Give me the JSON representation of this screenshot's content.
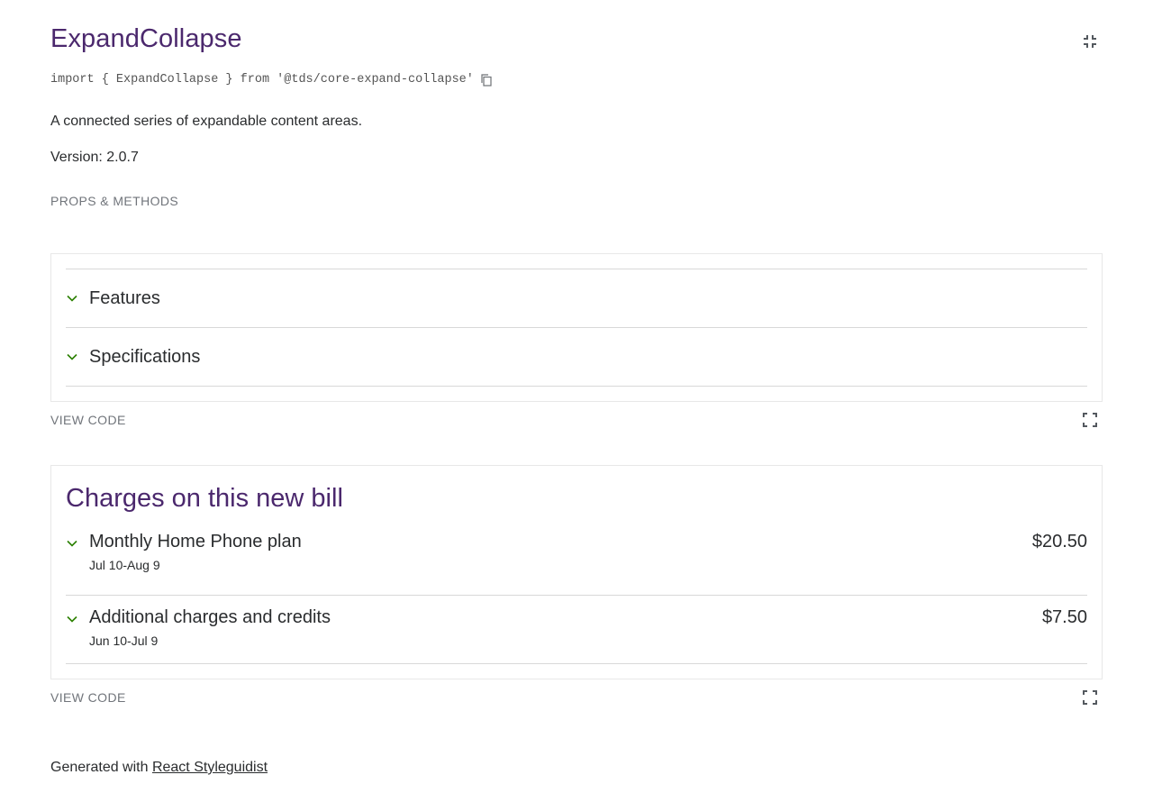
{
  "header": {
    "title": "ExpandCollapse",
    "import_statement": "import { ExpandCollapse } from '@tds/core-expand-collapse'",
    "description": "A connected series of expandable content areas.",
    "version": "Version: 2.0.7",
    "props_link": "PROPS & METHODS"
  },
  "example1": {
    "panels": [
      {
        "label": "Features"
      },
      {
        "label": "Specifications"
      }
    ],
    "view_code": "VIEW CODE"
  },
  "example2": {
    "title": "Charges on this new bill",
    "panels": [
      {
        "label": "Monthly Home Phone plan",
        "subtext": "Jul 10-Aug 9",
        "amount": "$20.50"
      },
      {
        "label": "Additional charges and credits",
        "subtext": "Jun 10-Jul 9",
        "amount": "$7.50"
      }
    ],
    "view_code": "VIEW CODE"
  },
  "footer": {
    "prefix": "Generated with ",
    "link": "React Styleguidist"
  },
  "colors": {
    "brand_purple": "#4b286d",
    "chevron_green": "#2b8000",
    "text": "#2a2c2e",
    "muted": "#71757b"
  },
  "icons": {
    "collapse": "fullscreen-exit-icon",
    "expand": "fullscreen-icon",
    "copy": "copy-icon",
    "chevron": "chevron-down-icon"
  }
}
